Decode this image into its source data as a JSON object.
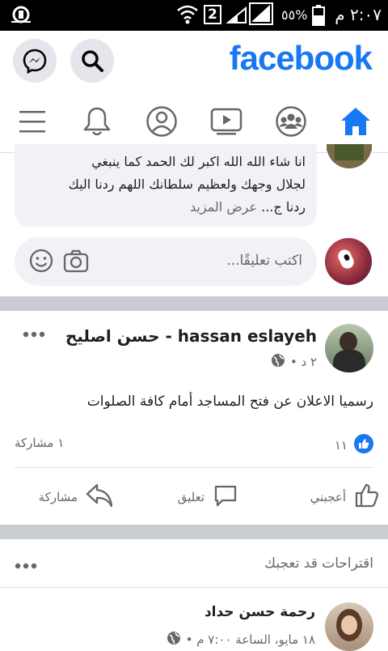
{
  "status_bar": {
    "time": "٢:٠٧ م",
    "battery": "٥٥%",
    "sim": "2"
  },
  "header": {
    "logo": "facebook"
  },
  "nav": {
    "tabs": [
      "home",
      "groups",
      "watch",
      "profile",
      "notifications",
      "menu"
    ],
    "active": "home"
  },
  "comment": {
    "line1": "انا شاء الله  الله اكبر لك الحمد كما ينبغي",
    "line2": "لجلال وجهك ولعظيم سلطانك اللهم ردنا اليك",
    "line3": "ردنا ج...",
    "see_more": "عرض المزيد"
  },
  "comment_input": {
    "placeholder": "اكتب تعليقًا..."
  },
  "post": {
    "author": "حسن اصليح - hassan eslayeh",
    "meta": "٢ د •",
    "text": "رسميا الاعلان عن فتح  المساجد أمام كافة الصلوات",
    "likes": "١١",
    "shares": "١ مشاركة",
    "actions": {
      "like": "أعجبني",
      "comment": "تعليق",
      "share": "مشاركة"
    }
  },
  "suggestions": {
    "title": "اقتراحات قد تعجبك",
    "person_name": "رحمة حسن حداد",
    "person_meta": "١٨ مايو، الساعة ٧:٠٠ م •"
  },
  "colors": {
    "brand": "#1877f2",
    "text": "#1c1e21",
    "secondary": "#65676b"
  }
}
